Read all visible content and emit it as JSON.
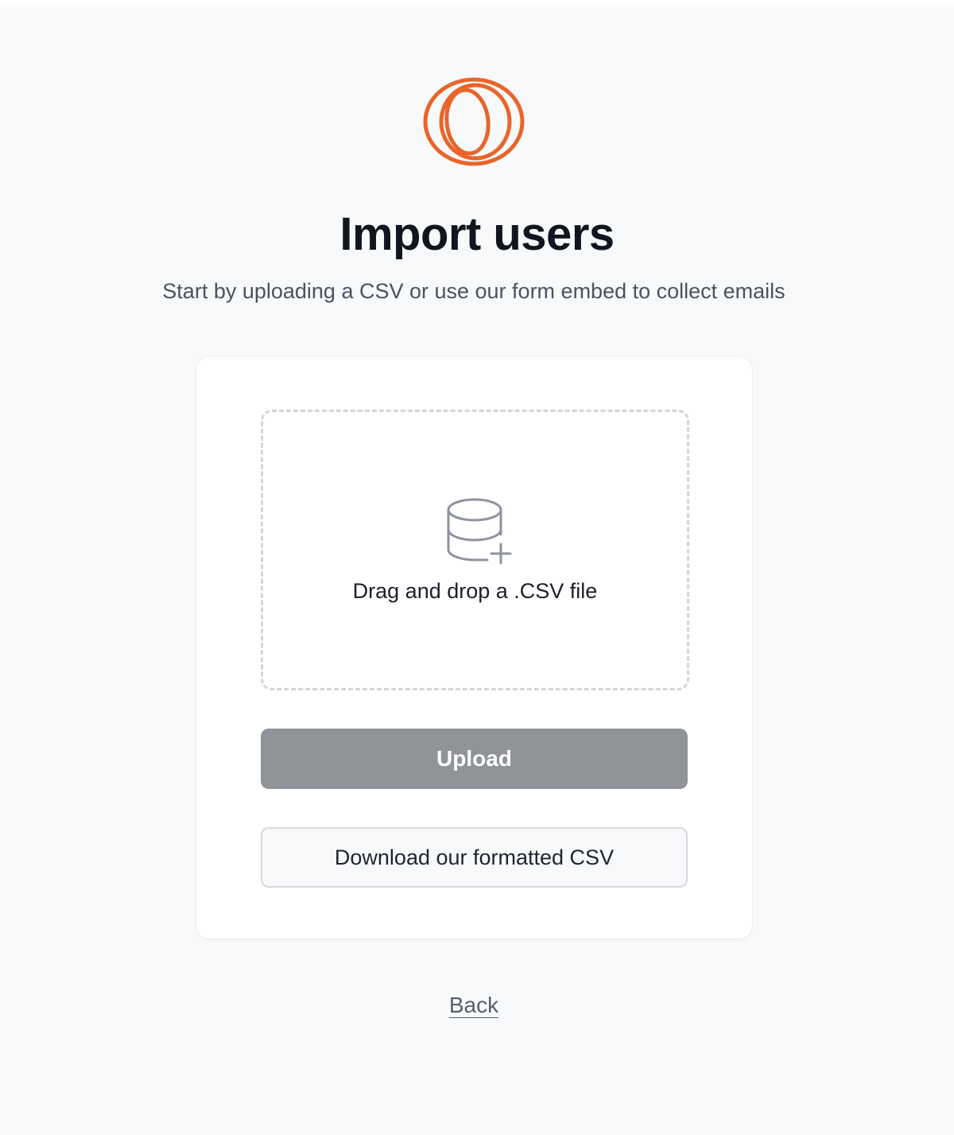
{
  "brand": {
    "logo_icon": "orange-loop-logo-icon",
    "accent_color": "#e8652a"
  },
  "header": {
    "title": "Import users",
    "subtitle": "Start by uploading a CSV or use our form embed to collect emails"
  },
  "upload_card": {
    "dropzone": {
      "icon": "database-plus-icon",
      "label": "Drag and drop a .CSV file"
    },
    "upload_button": {
      "label": "Upload",
      "state": "disabled",
      "color": "#909398"
    },
    "download_button": {
      "label": "Download our formatted CSV"
    }
  },
  "footer": {
    "back_label": "Back"
  }
}
